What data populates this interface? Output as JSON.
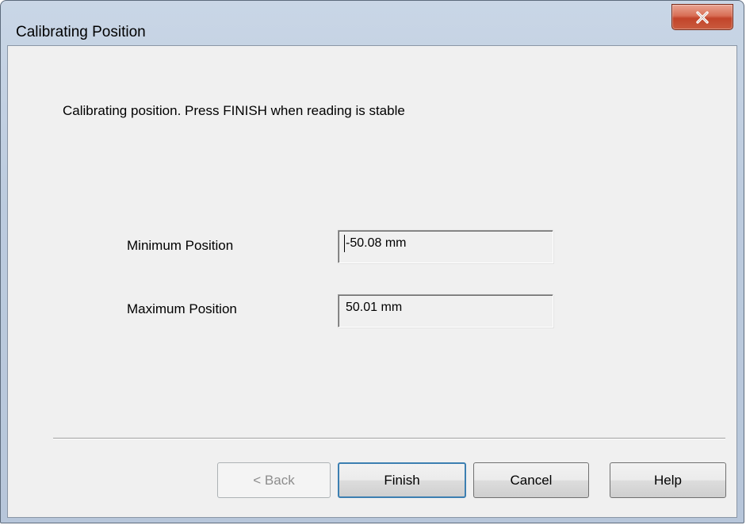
{
  "window": {
    "title": "Calibrating Position",
    "close_icon": "close-x-icon"
  },
  "content": {
    "instruction": "Calibrating position. Press FINISH when reading is stable"
  },
  "fields": {
    "minimum": {
      "label": "Minimum Position",
      "value": "-50.08 mm"
    },
    "maximum": {
      "label": "Maximum Position",
      "value": "50.01 mm"
    }
  },
  "buttons": {
    "back": "< Back",
    "finish": "Finish",
    "cancel": "Cancel",
    "help": "Help"
  },
  "colors": {
    "close_button": "#c2442a",
    "default_button_border": "#3c7fb1",
    "dialog_background": "#f0f0f0"
  }
}
